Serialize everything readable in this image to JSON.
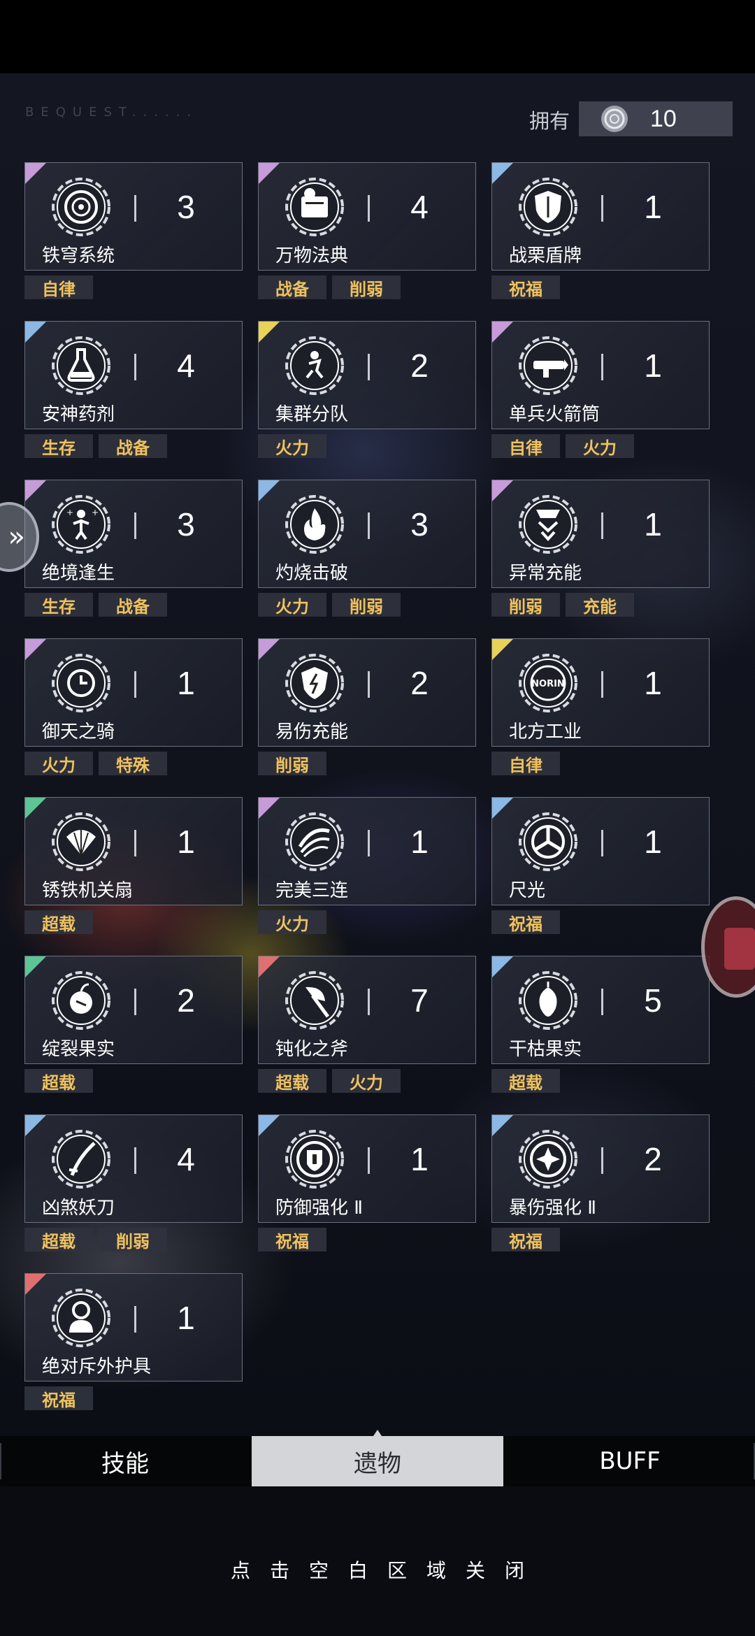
{
  "header": {
    "bequest_label": "BEQUEST......",
    "own_label": "拥有",
    "own_count": "10"
  },
  "relics": [
    {
      "name": "铁穹系统",
      "count": "3",
      "corner": "purple",
      "icon": "target-emblem-icon",
      "tags": [
        "自律"
      ]
    },
    {
      "name": "万物法典",
      "count": "4",
      "corner": "purple",
      "icon": "codex-book-icon",
      "tags": [
        "战备",
        "削弱"
      ]
    },
    {
      "name": "战栗盾牌",
      "count": "1",
      "corner": "blue",
      "icon": "shield-icon",
      "tags": [
        "祝福"
      ]
    },
    {
      "name": "安神药剂",
      "count": "4",
      "corner": "blue",
      "icon": "potion-flask-icon",
      "tags": [
        "生存",
        "战备"
      ]
    },
    {
      "name": "集群分队",
      "count": "2",
      "corner": "yellow",
      "icon": "squad-runner-icon",
      "tags": [
        "火力"
      ]
    },
    {
      "name": "单兵火箭筒",
      "count": "1",
      "corner": "purple",
      "icon": "rocket-launcher-icon",
      "tags": [
        "自律",
        "火力"
      ]
    },
    {
      "name": "绝境逢生",
      "count": "3",
      "corner": "purple",
      "icon": "revive-figure-icon",
      "tags": [
        "生存",
        "战备"
      ]
    },
    {
      "name": "灼烧击破",
      "count": "3",
      "corner": "blue",
      "icon": "flame-icon",
      "tags": [
        "火力",
        "削弱"
      ]
    },
    {
      "name": "异常充能",
      "count": "1",
      "corner": "purple",
      "icon": "energy-chevron-icon",
      "tags": [
        "削弱",
        "充能"
      ]
    },
    {
      "name": "御天之骑",
      "count": "1",
      "corner": "purple",
      "icon": "clock-target-icon",
      "tags": [
        "火力",
        "特殊"
      ]
    },
    {
      "name": "易伤充能",
      "count": "2",
      "corner": "purple",
      "icon": "lightning-shield-icon",
      "tags": [
        "削弱"
      ]
    },
    {
      "name": "北方工业",
      "count": "1",
      "corner": "yellow",
      "icon": "norin-logo-icon",
      "tags": [
        "自律"
      ]
    },
    {
      "name": "锈铁机关扇",
      "count": "1",
      "corner": "green",
      "icon": "iron-fan-icon",
      "tags": [
        "超载"
      ]
    },
    {
      "name": "完美三连",
      "count": "1",
      "corner": "purple",
      "icon": "triple-slash-icon",
      "tags": [
        "火力"
      ]
    },
    {
      "name": "尺光",
      "count": "1",
      "corner": "blue",
      "icon": "tri-blade-icon",
      "tags": [
        "祝福"
      ]
    },
    {
      "name": "绽裂果实",
      "count": "2",
      "corner": "green",
      "icon": "burst-fruit-icon",
      "tags": [
        "超载"
      ]
    },
    {
      "name": "钝化之斧",
      "count": "7",
      "corner": "red",
      "icon": "axe-icon",
      "tags": [
        "超载",
        "火力"
      ]
    },
    {
      "name": "干枯果实",
      "count": "5",
      "corner": "blue",
      "icon": "withered-fruit-icon",
      "tags": [
        "超载"
      ]
    },
    {
      "name": "凶煞妖刀",
      "count": "4",
      "corner": "blue",
      "icon": "demon-blade-icon",
      "tags": [
        "超载",
        "削弱"
      ]
    },
    {
      "name": "防御强化 Ⅱ",
      "count": "1",
      "corner": "blue",
      "icon": "defense-badge-icon",
      "tags": [
        "祝福"
      ]
    },
    {
      "name": "暴伤强化 Ⅱ",
      "count": "2",
      "corner": "blue",
      "icon": "crit-star-icon",
      "tags": [
        "祝福"
      ]
    },
    {
      "name": "绝对斥外护具",
      "count": "1",
      "corner": "red",
      "icon": "armor-figure-icon",
      "tags": [
        "祝福"
      ]
    }
  ],
  "tabs": [
    {
      "label": "技能",
      "active": false
    },
    {
      "label": "遗物",
      "active": true
    },
    {
      "label": "BUFF",
      "active": false
    }
  ],
  "footer": {
    "close_hint": "点击空白区域关闭"
  }
}
